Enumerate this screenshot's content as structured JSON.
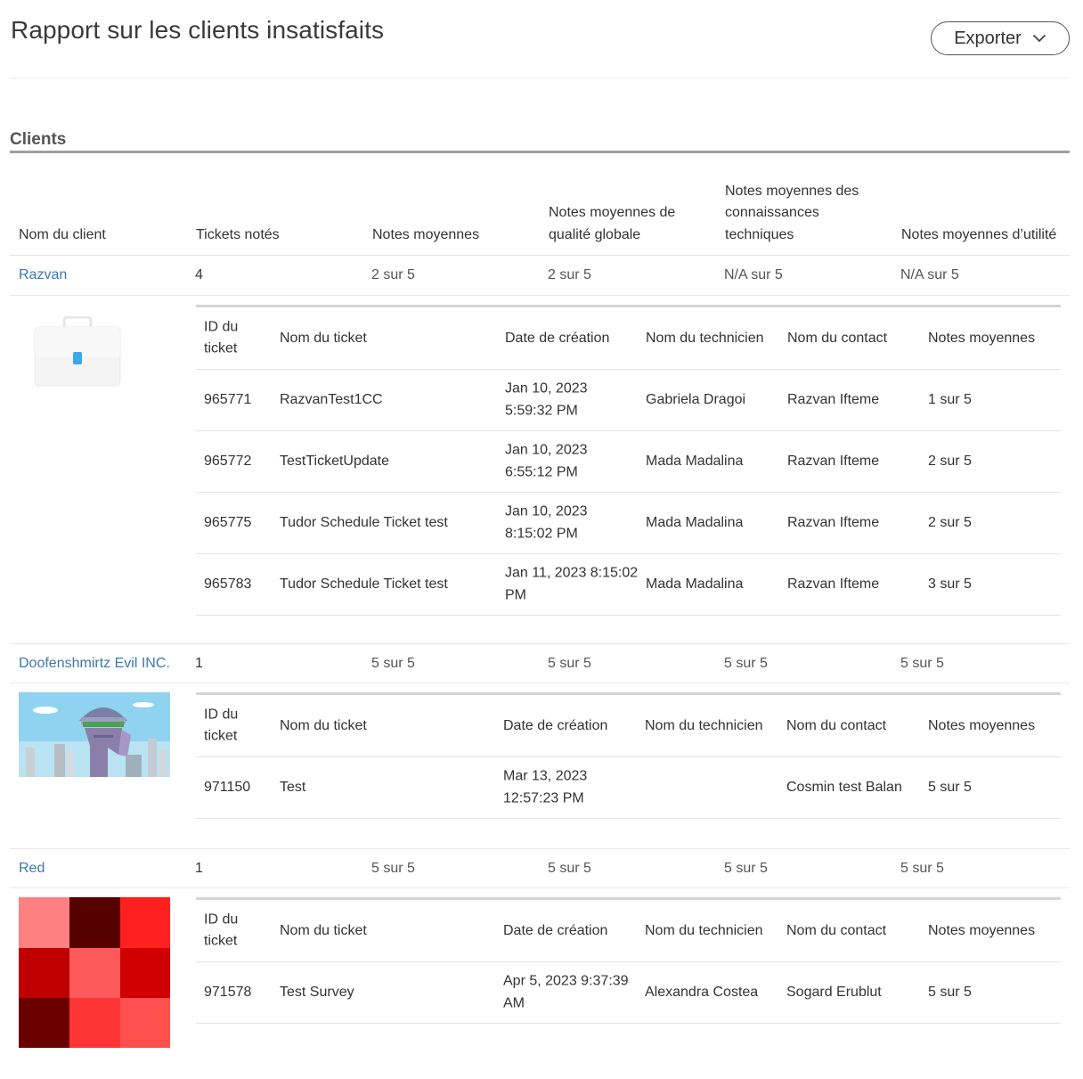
{
  "page": {
    "title": "Rapport sur les clients insatisfaits",
    "export_label": "Exporter",
    "section_title": "Clients"
  },
  "columns": {
    "client_name": "Nom du client",
    "rated_tickets": "Tickets notés",
    "avg_ratings": "Notes moyennes",
    "avg_overall": "Notes moyennes de qualité globale",
    "avg_technical": "Notes moyennes des connaissances techniques",
    "avg_usefulness": "Notes moyennes d’utilité"
  },
  "sub_columns": {
    "ticket_id": "ID du ticket",
    "ticket_name": "Nom du ticket",
    "created": "Date de création",
    "technician": "Nom du technicien",
    "contact": "Nom du contact",
    "avg": "Notes moyennes"
  },
  "clients": [
    {
      "name": "Razvan",
      "rated": "4",
      "avg": "2 sur 5",
      "overall": "2 sur 5",
      "technical": "N/A sur 5",
      "usefulness": "N/A sur 5",
      "tickets": [
        {
          "id": "965771",
          "name": "RazvanTest1CC",
          "created": "Jan 10, 2023 5:59:32 PM",
          "technician": "Gabriela Dragoi",
          "contact": "Razvan Ifteme",
          "avg": "1 sur 5"
        },
        {
          "id": "965772",
          "name": "TestTicketUpdate",
          "created": "Jan 10, 2023 6:55:12 PM",
          "technician": "Mada Madalina",
          "contact": "Razvan Ifteme",
          "avg": "2 sur 5"
        },
        {
          "id": "965775",
          "name": "Tudor Schedule Ticket test",
          "created": "Jan 10, 2023 8:15:02 PM",
          "technician": "Mada Madalina",
          "contact": "Razvan Ifteme",
          "avg": "2 sur 5"
        },
        {
          "id": "965783",
          "name": "Tudor Schedule Ticket test",
          "created": "Jan 11, 2023 8:15:02 PM",
          "technician": "Mada Madalina",
          "contact": "Razvan Ifteme",
          "avg": "3 sur 5"
        }
      ]
    },
    {
      "name": "Doofenshmirtz Evil INC.",
      "rated": "1",
      "avg": "5 sur 5",
      "overall": "5 sur 5",
      "technical": "5 sur 5",
      "usefulness": "5 sur 5",
      "tickets": [
        {
          "id": "971150",
          "name": "Test",
          "created": "Mar 13, 2023 12:57:23 PM",
          "technician": "",
          "contact": "Cosmin test Balan",
          "avg": "5 sur 5"
        }
      ]
    },
    {
      "name": "Red",
      "rated": "1",
      "avg": "5 sur 5",
      "overall": "5 sur 5",
      "technical": "5 sur 5",
      "usefulness": "5 sur 5",
      "tickets": [
        {
          "id": "971578",
          "name": "Test Survey",
          "created": "Apr 5, 2023 9:37:39 AM",
          "technician": "Alexandra Costea",
          "contact": "Sogard Erublut",
          "avg": "5 sur 5"
        }
      ]
    }
  ]
}
